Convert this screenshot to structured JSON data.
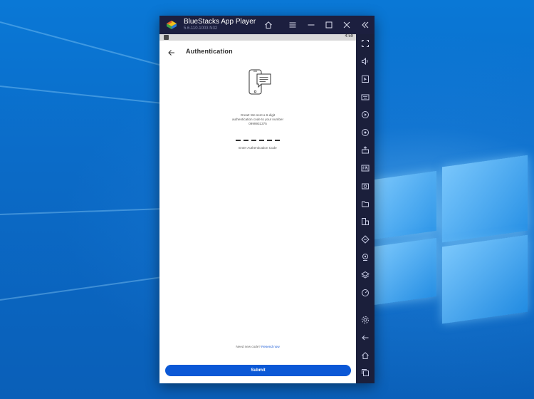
{
  "window": {
    "title": "BlueStacks App Player",
    "version": "5.6.110.1003  N32"
  },
  "status_bar": {
    "time": "4:59"
  },
  "page": {
    "title": "Authentication",
    "message_line1": "Great! We sent a 6-digit",
    "message_line2": "authentication code to your number",
    "message_number": "0999931375",
    "code_placeholder": "Enter Authentication Code",
    "code_length": 6,
    "resend_prompt": "Need new code?",
    "resend_link": "Resend now",
    "submit_label": "Submit"
  },
  "colors": {
    "accent": "#0b58d6",
    "window_chrome": "#1b1f3b",
    "desktop": "#0a6fcf"
  },
  "titlebar_icons": [
    "home-icon",
    "menu-icon",
    "minimize-icon",
    "maximize-icon",
    "close-icon",
    "collapse-sidebar-icon"
  ],
  "sidebar_icons": [
    "fullscreen-icon",
    "volume-icon",
    "pointer-icon",
    "keyboard-icon",
    "record-icon",
    "rotate-icon",
    "install-apk-icon",
    "fps-icon",
    "screenshot-icon",
    "folder-icon",
    "multi-instance-icon",
    "eco-mode-icon",
    "location-icon",
    "layers-icon",
    "performance-icon",
    "settings-icon",
    "back-icon",
    "home-icon",
    "recent-apps-icon"
  ]
}
